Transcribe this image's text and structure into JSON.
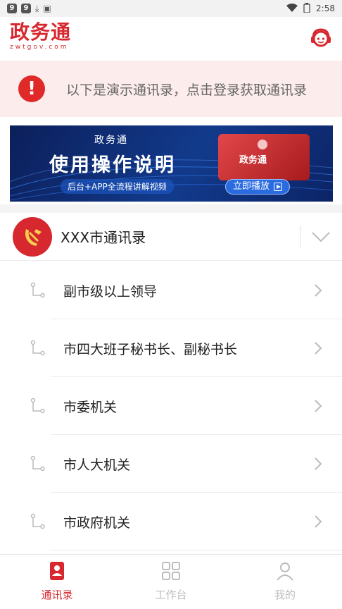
{
  "status_bar": {
    "badge_1": "9",
    "badge_2": "9",
    "time": "2:58"
  },
  "header": {
    "logo_text": "政务通",
    "logo_sub": "zwtgov.com"
  },
  "notice": {
    "text": "以下是演示通讯录，点击登录获取通讯录"
  },
  "banner": {
    "small_title": "政务通",
    "title": "使用操作说明",
    "subtitle": "后台+APP全流程讲解视频",
    "card_text": "政务通",
    "play_label": "立即播放"
  },
  "directory": {
    "title": "XXX市通讯录",
    "items": [
      {
        "label": "副市级以上领导"
      },
      {
        "label": "市四大班子秘书长、副秘书长"
      },
      {
        "label": "市委机关"
      },
      {
        "label": "市人大机关"
      },
      {
        "label": "市政府机关"
      }
    ]
  },
  "tabbar": {
    "tabs": [
      {
        "label": "通讯录"
      },
      {
        "label": "工作台"
      },
      {
        "label": "我的"
      }
    ]
  },
  "colors": {
    "brand": "#d7282f",
    "notice_bg": "#fdecec",
    "inactive": "#bdbdbd"
  }
}
